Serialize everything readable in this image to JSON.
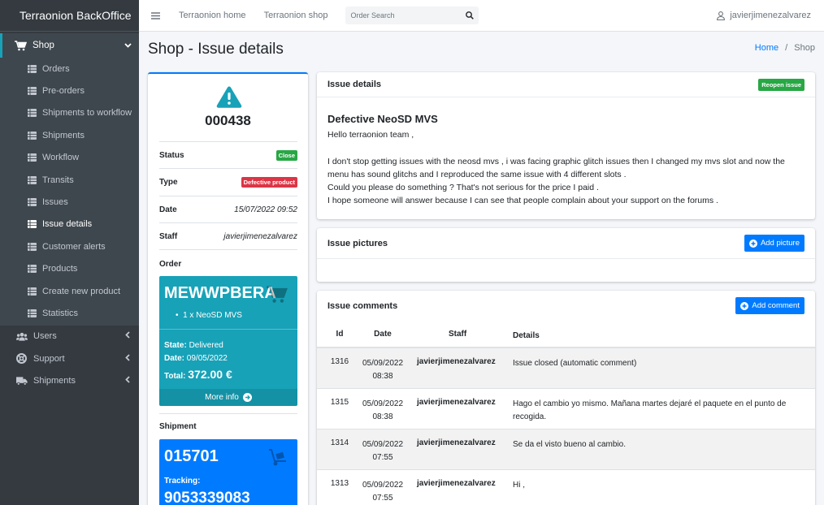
{
  "brand": "Terraonion BackOffice",
  "sidebar": {
    "shop_label": "Shop",
    "shop_items": [
      {
        "label": "Orders",
        "active": false
      },
      {
        "label": "Pre-orders",
        "active": false
      },
      {
        "label": "Shipments to workflow",
        "active": false
      },
      {
        "label": "Shipments",
        "active": false
      },
      {
        "label": "Workflow",
        "active": false
      },
      {
        "label": "Transits",
        "active": false
      },
      {
        "label": "Issues",
        "active": false
      },
      {
        "label": "Issue details",
        "active": true
      },
      {
        "label": "Customer alerts",
        "active": false
      },
      {
        "label": "Products",
        "active": false
      },
      {
        "label": "Create new product",
        "active": false
      },
      {
        "label": "Statistics",
        "active": false
      }
    ],
    "users_label": "Users",
    "support_label": "Support",
    "shipments_label": "Shipments"
  },
  "topbar": {
    "home_link": "Terraonion home",
    "shop_link": "Terraonion shop",
    "search_placeholder": "Order Search",
    "username": "javierjimenezalvarez"
  },
  "page": {
    "title": "Shop - Issue details",
    "breadcrumb_home": "Home",
    "breadcrumb_sep": "/",
    "breadcrumb_current": "Shop"
  },
  "summary": {
    "issue_number": "000438",
    "status_label": "Status",
    "status_value": "Close",
    "type_label": "Type",
    "type_value": "Defective product",
    "date_label": "Date",
    "date_value": "15/07/2022 09:52",
    "staff_label": "Staff",
    "staff_value": "javierjimenezalvarez",
    "order_heading": "Order",
    "order": {
      "code": "MEWWPBERA",
      "item": "1 x NeoSD MVS",
      "state_label": "State:",
      "state_value": "Delivered",
      "date_label": "Date:",
      "date_value": "09/05/2022",
      "total_label": "Total:",
      "total_value": "372.00 €",
      "more_info": "More info"
    },
    "shipment_heading": "Shipment",
    "shipment": {
      "number": "015701",
      "tracking_label": "Tracking:",
      "tracking_value": "9053339083"
    }
  },
  "details": {
    "header": "Issue details",
    "reopen_button": "Reopen issue",
    "title": "Defective NeoSD MVS",
    "lines": [
      "Hello terraonion team ,",
      "",
      "I don't stop getting issues with the neosd mvs , i was facing graphic glitch issues then I changed my mvs slot and now the menu has sound glitchs and I reproduced the same issue with 4 different slots .",
      "Could you please do something ? That's not serious for the price I paid .",
      "I hope someone will answer because I can see that people complain about your support on the forums ."
    ]
  },
  "pictures": {
    "header": "Issue pictures",
    "add_button": "Add picture"
  },
  "comments": {
    "header": "Issue comments",
    "add_button": "Add comment",
    "columns": {
      "id": "Id",
      "date": "Date",
      "staff": "Staff",
      "details": "Details"
    },
    "rows": [
      {
        "id": "1316",
        "date": "05/09/2022",
        "time": "08:38",
        "staff": "javierjimenezalvarez",
        "details": "Issue closed (automatic comment)"
      },
      {
        "id": "1315",
        "date": "05/09/2022",
        "time": "08:38",
        "staff": "javierjimenezalvarez",
        "details": "Hago el cambio yo mismo. Mañana martes dejaré el paquete en el punto de recogida."
      },
      {
        "id": "1314",
        "date": "05/09/2022",
        "time": "07:55",
        "staff": "javierjimenezalvarez",
        "details": "Se da el visto bueno al cambio."
      },
      {
        "id": "1313",
        "date": "05/09/2022",
        "time": "07:55",
        "staff": "javierjimenezalvarez",
        "details": "Hi ,"
      }
    ]
  },
  "colors": {
    "sidebar_bg": "#343a40",
    "primary": "#007bff",
    "info": "#17a2b8",
    "success": "#28a745",
    "danger": "#dc3545",
    "warning_icon": "#17a2b8"
  }
}
